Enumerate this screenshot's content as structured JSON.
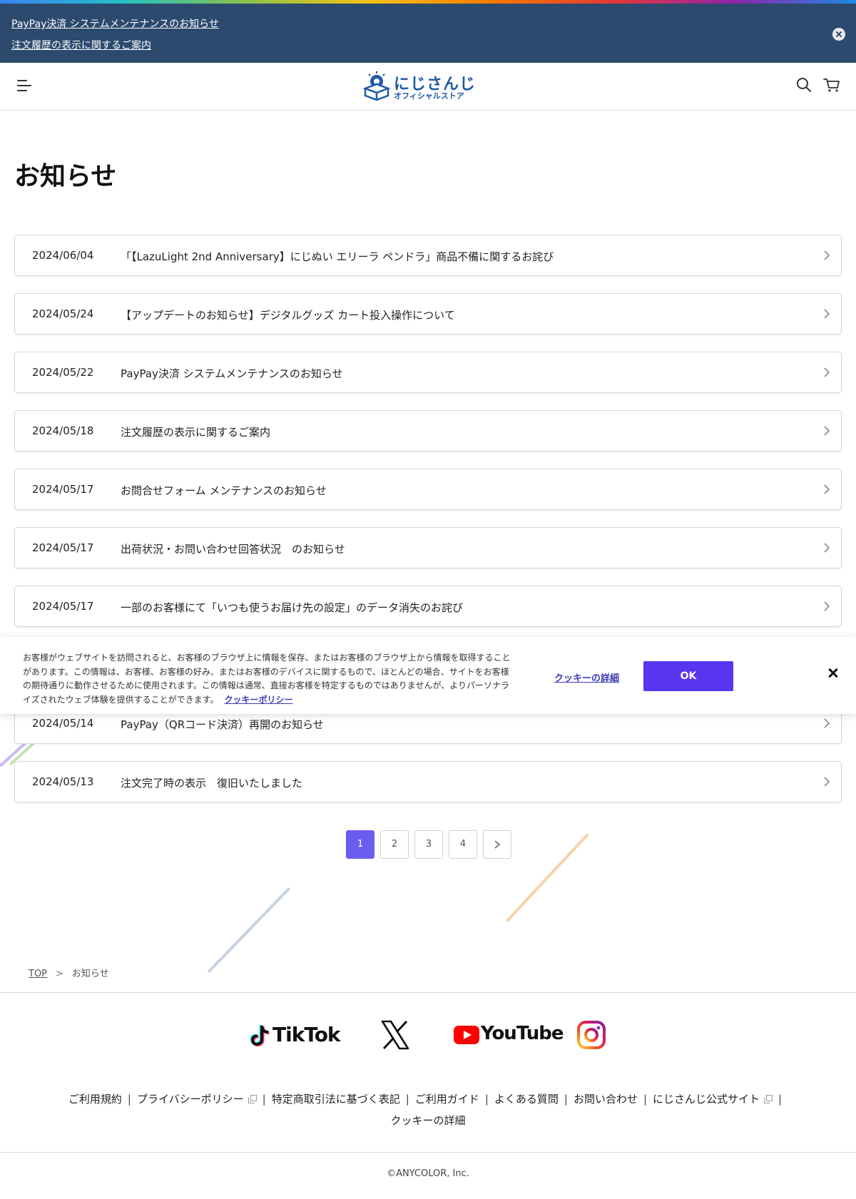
{
  "notice_bar": {
    "links": [
      "PayPay決済 システムメンテナンスのお知らせ",
      "注文履歴の表示に関するご案内"
    ]
  },
  "header": {
    "logo_line1": "にじさんじ",
    "logo_line2": "オフィシャルストア"
  },
  "page_title": "お知らせ",
  "news": [
    {
      "date": "2024/06/04",
      "title": "「【LazuLight 2nd Anniversary】にじぬい エリーラ ペンドラ」商品不備に関するお詫び"
    },
    {
      "date": "2024/05/24",
      "title": "【アップデートのお知らせ】デジタルグッズ カート投入操作について"
    },
    {
      "date": "2024/05/22",
      "title": "PayPay決済 システムメンテナンスのお知らせ"
    },
    {
      "date": "2024/05/18",
      "title": "注文履歴の表示に関するご案内"
    },
    {
      "date": "2024/05/17",
      "title": "お問合せフォーム メンテナンスのお知らせ"
    },
    {
      "date": "2024/05/17",
      "title": "出荷状況・お問い合わせ回答状況　のお知らせ"
    },
    {
      "date": "2024/05/17",
      "title": "一部のお客様にて「いつも使うお届け先の設定」のデータ消失のお詫び"
    },
    {
      "date": "2024/05/14",
      "title": "PayPay（QRコード決済）再開のお知らせ"
    },
    {
      "date": "2024/05/13",
      "title": "注文完了時の表示　復旧いたしました"
    }
  ],
  "pagination": {
    "pages": [
      "1",
      "2",
      "3",
      "4"
    ],
    "current": "1"
  },
  "cookie_banner": {
    "text": "お客様がウェブサイトを訪問されると、お客様のブラウザ上に情報を保存、またはお客様のブラウザ上から情報を取得することがあります。この情報は、お客様、お客様の好み、またはお客様のデバイスに関するもので、ほとんどの場合、サイトをお客様の期待通りに動作させるために使用されます。この情報は通常、直接お客様を特定するものではありませんが、よりパーソナライズされたウェブ体験を提供することができます。",
    "policy_link": "クッキーポリシー",
    "details_link": "クッキーの詳細",
    "ok_label": "OK"
  },
  "breadcrumb": {
    "top": "TOP",
    "separator": ">",
    "current": "お知らせ"
  },
  "social": {
    "tiktok": "TikTok",
    "youtube": "YouTube"
  },
  "footer": {
    "links": [
      "ご利用規約",
      "プライバシーポリシー",
      "特定商取引法に基づく表記",
      "ご利用ガイド",
      "よくある質問",
      "お問い合わせ",
      "にじさんじ公式サイト",
      "クッキーの詳細"
    ],
    "copyright": "©ANYCOLOR, Inc."
  },
  "colors": {
    "notice_bg": "#2c4a6e",
    "accent": "#6b5cf0",
    "cookie_ok": "#5a35f0",
    "logo_blue": "#1f5aa8"
  }
}
